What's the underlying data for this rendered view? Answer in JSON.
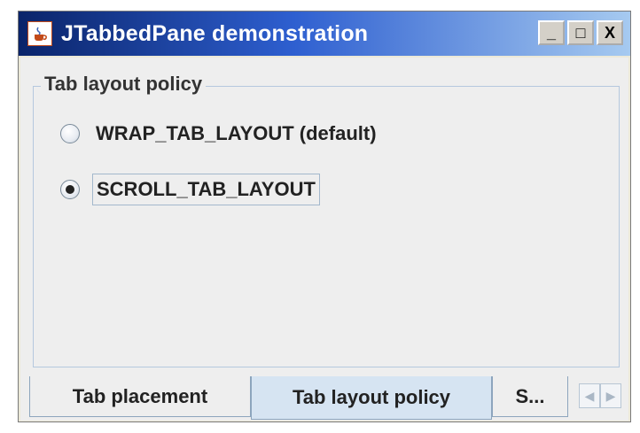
{
  "window": {
    "title": "JTabbedPane demonstration",
    "controls": {
      "minimize": "_",
      "maximize": "□",
      "close": "X"
    },
    "icon": "java-cup-icon"
  },
  "group": {
    "title": "Tab layout policy",
    "options": [
      {
        "label": "WRAP_TAB_LAYOUT (default)",
        "selected": false
      },
      {
        "label": "SCROLL_TAB_LAYOUT",
        "selected": true
      }
    ]
  },
  "tabs": [
    {
      "label": "Tab placement",
      "selected": false
    },
    {
      "label": "Tab layout policy",
      "selected": true
    },
    {
      "label": "S...",
      "selected": false
    }
  ],
  "scroll": {
    "left": "◀",
    "right": "▶"
  }
}
